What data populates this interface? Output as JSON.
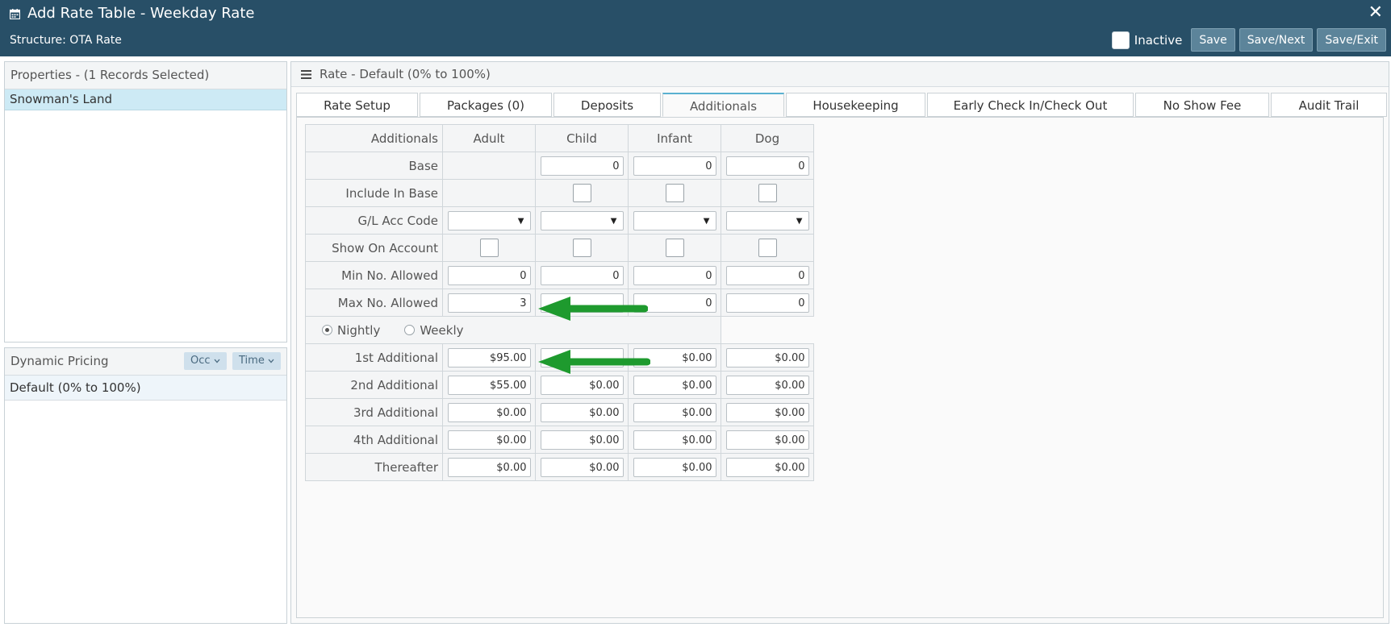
{
  "header": {
    "title": "Add Rate Table - Weekday Rate",
    "subtitle": "Structure: OTA Rate",
    "inactive_label": "Inactive",
    "save_label": "Save",
    "save_next_label": "Save/Next",
    "save_exit_label": "Save/Exit",
    "close_glyph": "✕"
  },
  "properties": {
    "title": "Properties - (1 Records Selected)",
    "items": [
      "Snowman's Land"
    ]
  },
  "dynamic_pricing": {
    "title": "Dynamic Pricing",
    "occ_label": "Occ",
    "time_label": "Time",
    "items": [
      "Default (0% to 100%)"
    ]
  },
  "main": {
    "title": "Rate - Default (0% to 100%)",
    "tabs": [
      "Rate Setup",
      "Packages (0)",
      "Deposits",
      "Additionals",
      "Housekeeping",
      "Early Check In/Check Out",
      "No Show Fee",
      "Audit Trail"
    ],
    "active_tab": "Additionals"
  },
  "grid": {
    "header_label": "Additionals",
    "columns": [
      "Adult",
      "Child",
      "Infant",
      "Dog"
    ],
    "base_label": "Base",
    "base": [
      "",
      "0",
      "0",
      "0"
    ],
    "include_in_base_label": "Include In Base",
    "gl_code_label": "G/L Acc Code",
    "show_on_account_label": "Show On Account",
    "min_label": "Min No. Allowed",
    "min": [
      "0",
      "0",
      "0",
      "0"
    ],
    "max_label": "Max No. Allowed",
    "max": [
      "3",
      "",
      "0",
      "0"
    ],
    "nightly_label": "Nightly",
    "weekly_label": "Weekly",
    "first_label": "1st Additional",
    "first": [
      "$95.00",
      "",
      "$0.00",
      "$0.00"
    ],
    "second_label": "2nd Additional",
    "second": [
      "$55.00",
      "$0.00",
      "$0.00",
      "$0.00"
    ],
    "third_label": "3rd Additional",
    "third": [
      "$0.00",
      "$0.00",
      "$0.00",
      "$0.00"
    ],
    "fourth_label": "4th Additional",
    "fourth": [
      "$0.00",
      "$0.00",
      "$0.00",
      "$0.00"
    ],
    "thereafter_label": "Thereafter",
    "thereafter": [
      "$0.00",
      "$0.00",
      "$0.00",
      "$0.00"
    ]
  },
  "colors": {
    "header_bg": "#284f67",
    "button_bg": "#5c849a",
    "selected_row": "#cdeaf5",
    "active_tab_border": "#5ab1d0",
    "arrow": "#1e9a2e"
  }
}
